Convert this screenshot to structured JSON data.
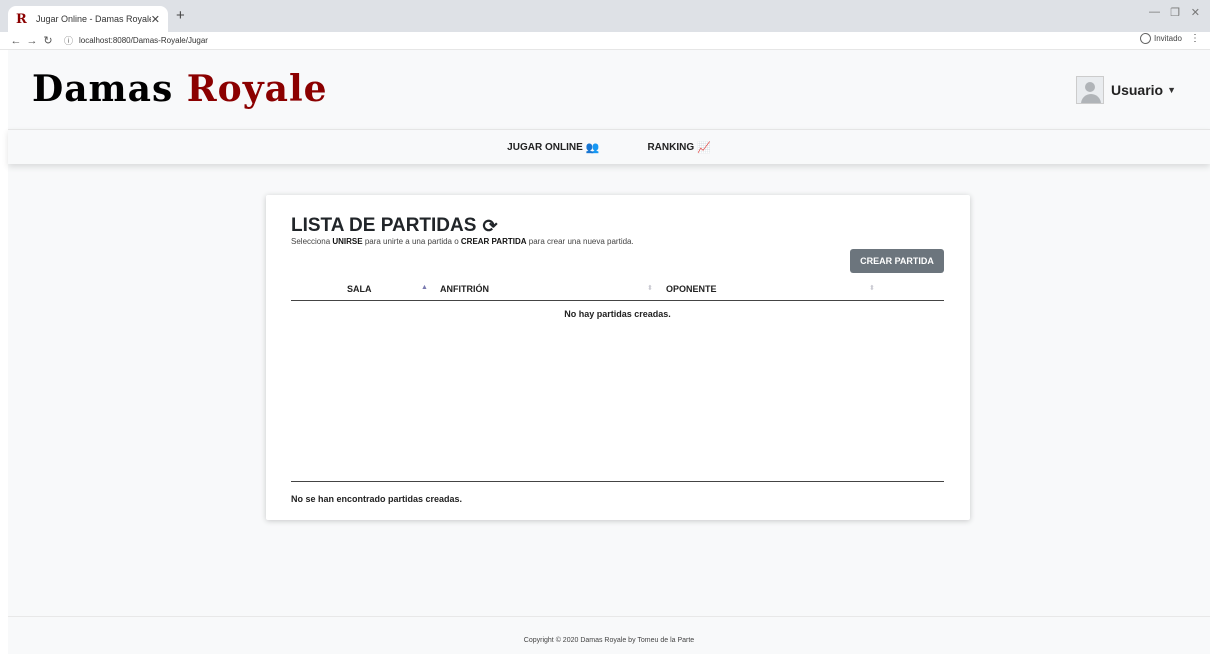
{
  "browser": {
    "tab_title": "Jugar Online - Damas Royale",
    "tab_favicon": "R",
    "url": "localhost:8080/Damas-Royale/Jugar",
    "profile_label": "Invitado"
  },
  "header": {
    "brand_part1": "Damas ",
    "brand_part2": "Royale",
    "user_label": "Usuario"
  },
  "nav": {
    "items": [
      {
        "label": "JUGAR ONLINE",
        "icon": "users-icon"
      },
      {
        "label": "RANKING",
        "icon": "chart-line-icon"
      }
    ]
  },
  "card": {
    "title": "LISTA DE PARTIDAS",
    "subtitle_1": "Selecciona ",
    "subtitle_b1": "UNIRSE",
    "subtitle_2": " para unirte a una partida o ",
    "subtitle_b2": "CREAR PARTIDA",
    "subtitle_3": " para crear una nueva partida.",
    "create_button": "CREAR PARTIDA",
    "columns": [
      "SALA",
      "ANFITRIÓN",
      "OPONENTE"
    ],
    "empty_message": "No hay partidas creadas.",
    "footer_message": "No se han encontrado partidas creadas."
  },
  "footer": {
    "copyright": "Copyright © 2020 Damas Royale by Tomeu de la Parte"
  },
  "colors": {
    "brand_accent": "#8b0000",
    "button_bg": "#6c757d"
  }
}
